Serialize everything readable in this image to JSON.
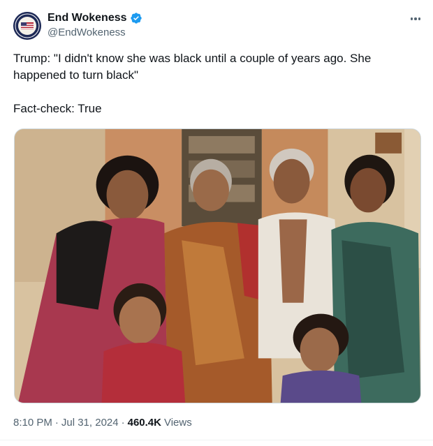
{
  "author": {
    "display_name": "End Wokeness",
    "handle": "@EndWokeness",
    "verified": true
  },
  "tweet": {
    "line1": "Trump: \"I didn't know she was black until a couple of years ago. She happened to turn black\"",
    "line2": "Fact-check: True"
  },
  "meta": {
    "time": "8:10 PM",
    "separator1": "·",
    "date": "Jul 31, 2024",
    "separator2": "·",
    "views_count": "460.4K",
    "views_label": "Views"
  },
  "icons": {
    "verified": "verified-badge-icon",
    "more": "more-options-icon"
  },
  "colors": {
    "verified_blue": "#1d9bf0",
    "text_primary": "#0f1419",
    "text_secondary": "#536471"
  }
}
